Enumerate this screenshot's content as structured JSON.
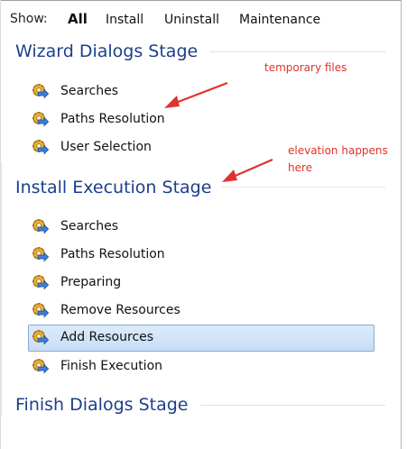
{
  "filter_bar": {
    "show_label": "Show:",
    "options": [
      "All",
      "Install",
      "Uninstall",
      "Maintenance"
    ],
    "active": "All"
  },
  "stages": [
    {
      "title": "Wizard Dialogs Stage",
      "items": [
        "Searches",
        "Paths Resolution",
        "User Selection"
      ]
    },
    {
      "title": "Install Execution Stage",
      "items": [
        "Searches",
        "Paths Resolution",
        "Preparing",
        "Remove Resources",
        "Add Resources",
        "Finish Execution"
      ]
    },
    {
      "title": "Finish Dialogs Stage",
      "items": []
    }
  ],
  "selected_item": "Add Resources",
  "annotations": [
    {
      "text": "temporary files"
    },
    {
      "text_lines": [
        "elevation happens",
        "here"
      ]
    }
  ],
  "colors": {
    "stage_title": "#1c3f8c",
    "annotation": "#e0322c",
    "selection_border": "#86a9d4"
  },
  "icons": {
    "item_icon": "gear-with-arrow-icon"
  }
}
